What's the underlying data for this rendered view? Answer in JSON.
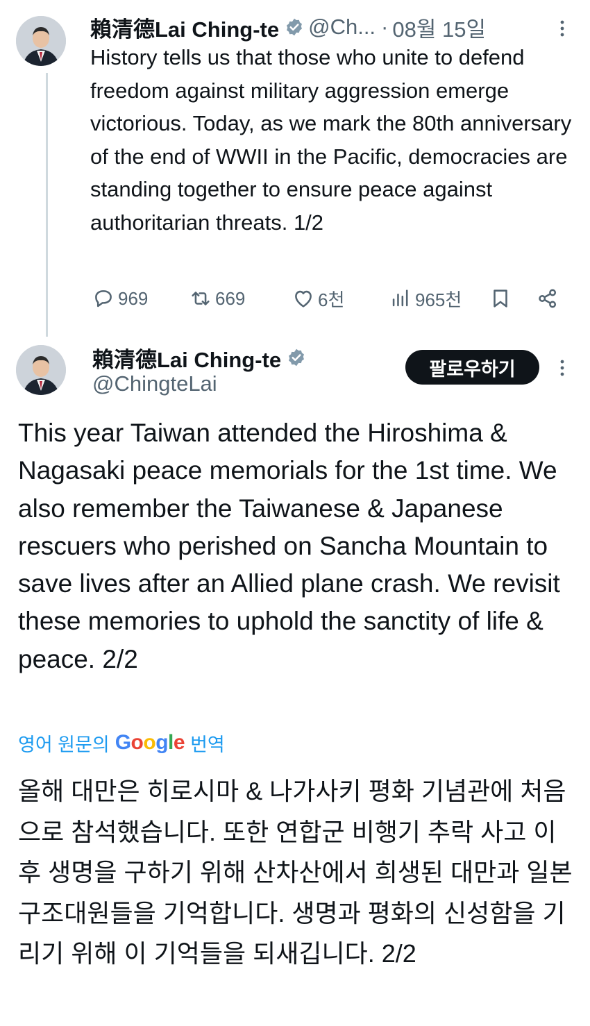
{
  "tweet1": {
    "name": "賴清德Lai Ching-te",
    "handle": "@Ch...",
    "separator": "·",
    "date": "08월 15일",
    "text": "History tells us that those who unite to defend freedom against military aggression emerge victorious. Today, as we mark the 80th anniversary of the end of WWII in the Pacific, democracies are standing together to ensure peace against authoritarian threats. 1/2",
    "replies": "969",
    "reposts": "669",
    "likes": "6천",
    "views": "965천"
  },
  "tweet2": {
    "name": "賴清德Lai Ching-te",
    "handle": "@ChingteLai",
    "follow_label": "팔로우하기",
    "text": "This year Taiwan attended the Hiroshima & Nagasaki peace memorials for the 1st time. We also remember the Taiwanese & Japanese rescuers who perished on Sancha Mountain to save lives after an Allied plane crash. We revisit these memories to uphold the sanctity of life & peace. 2/2",
    "translate_prefix": "영어 원문의",
    "translate_brand": "Google",
    "translate_suffix": "번역",
    "translated_text": "올해 대만은 히로시마 & 나가사키 평화 기념관에 처음으로 참석했습니다. 또한 연합군 비행기 추락 사고 이후 생명을 구하기 위해 산차산에서 희생된 대만과 일본 구조대원들을 기억합니다. 생명과 평화의 신성함을 기리기 위해 이 기억들을 되새깁니다. 2/2"
  },
  "icons": {
    "verified": "verified-badge-icon",
    "reply": "reply-icon",
    "repost": "repost-icon",
    "like": "heart-icon",
    "views": "views-icon",
    "bookmark": "bookmark-icon",
    "share": "share-icon",
    "more": "more-vertical-icon"
  },
  "colors": {
    "text": "#0f1419",
    "secondary": "#536471",
    "link": "#1d9bf0",
    "thread_line": "#cfd9de",
    "button_bg": "#0f1419"
  }
}
